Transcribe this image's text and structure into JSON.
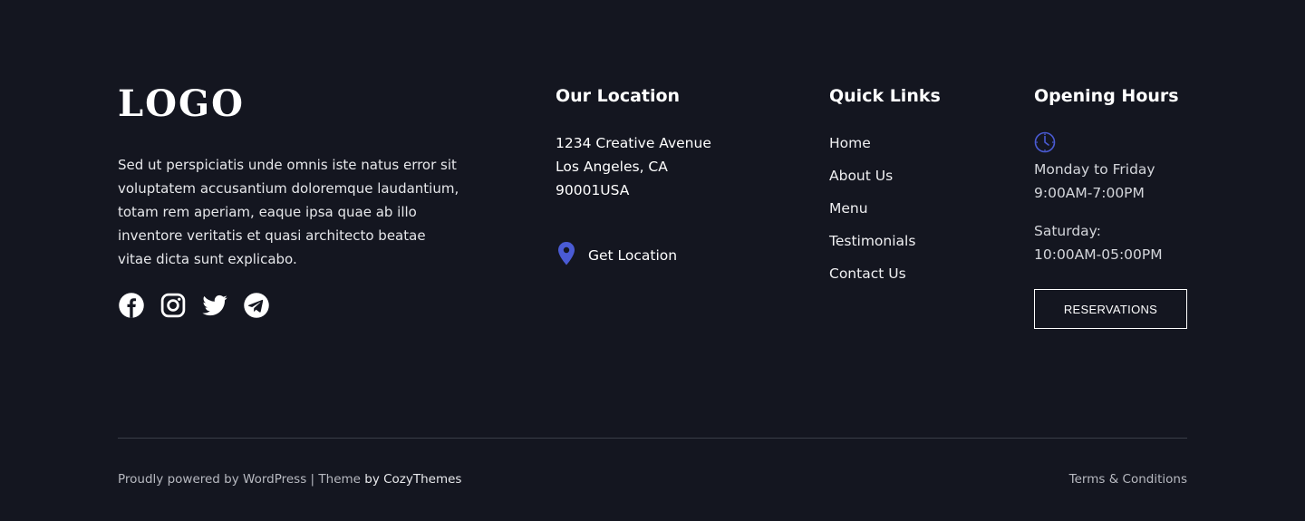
{
  "logo": {
    "text": "LOGO"
  },
  "about": {
    "text": "Sed ut perspiciatis unde omnis iste natus error sit voluptatem accusantium doloremque laudantium, totam rem aperiam, eaque ipsa quae ab illo inventore veritatis et quasi architecto beatae vitae dicta sunt explicabo."
  },
  "social": [
    "facebook-icon",
    "instagram-icon",
    "twitter-icon",
    "telegram-icon"
  ],
  "location": {
    "title": "Our Location",
    "address_line1": "1234 Creative Avenue",
    "address_line2": "Los Angeles, CA",
    "address_line3": "90001USA",
    "get_location_label": "Get Location"
  },
  "quick_links": {
    "title": "Quick Links",
    "items": [
      "Home",
      "About Us",
      "Menu",
      "Testimonials",
      "Contact Us"
    ]
  },
  "opening_hours": {
    "title": "Opening Hours",
    "weekday_label": "Monday to Friday",
    "weekday_hours": "9:00AM-7:00PM",
    "saturday_label": "Saturday:",
    "saturday_hours": "10:00AM-05:00PM",
    "reservations_label": "RESERVATIONS"
  },
  "bottom": {
    "powered_by": "Proudly powered by WordPress",
    "separator": " | ",
    "theme_prefix": "Theme ",
    "theme_by": "by CozyThemes",
    "terms": "Terms & Conditions"
  },
  "colors": {
    "background": "#141620",
    "accent": "#4a5bd4",
    "text": "#ffffff",
    "muted": "#b7b9c0"
  }
}
